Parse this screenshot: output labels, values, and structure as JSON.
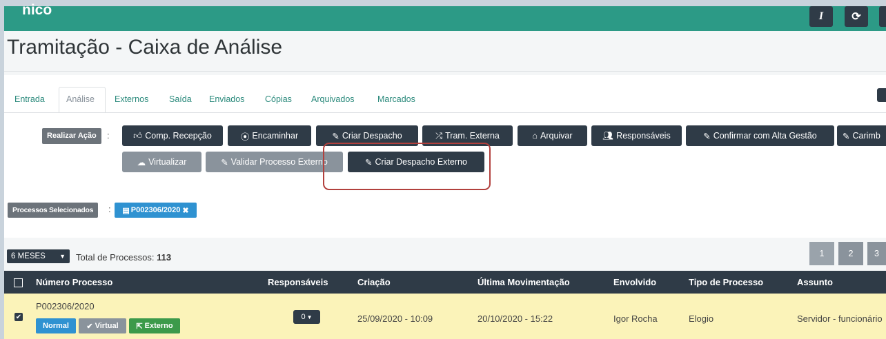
{
  "app": {
    "brand": "nico",
    "top_buttons": [
      {
        "icon": "italic-icon",
        "label": "I"
      },
      {
        "icon": "refresh-icon",
        "label": "⟳"
      }
    ]
  },
  "page_title": "Tramitação - Caixa de Análise",
  "tabs": [
    {
      "label": "Entrada",
      "active": false
    },
    {
      "label": "Análise",
      "active": true
    },
    {
      "label": "Externos",
      "active": false
    },
    {
      "label": "Saída",
      "active": false
    },
    {
      "label": "Enviados",
      "active": false
    },
    {
      "label": "Cópias",
      "active": false
    },
    {
      "label": "Arquivados",
      "active": false
    },
    {
      "label": "Marcados",
      "active": false
    }
  ],
  "actions": {
    "label": "Realizar Ação",
    "row1": [
      {
        "icon": "thumbs-up-icon",
        "label": "Comp. Recepção"
      },
      {
        "icon": "forward-circle-icon",
        "label": "Encaminhar"
      },
      {
        "icon": "edit-icon",
        "label": "Criar Despacho"
      },
      {
        "icon": "shuffle-icon",
        "label": "Tram. Externa"
      },
      {
        "icon": "inbox-icon",
        "label": "Arquivar"
      },
      {
        "icon": "users-icon",
        "label": "Responsáveis"
      },
      {
        "icon": "edit-icon",
        "label": "Confirmar com Alta Gestão"
      },
      {
        "icon": "pencil-icon",
        "label": "Carimb"
      }
    ],
    "row2": [
      {
        "icon": "cloud-upload-icon",
        "label": "Virtualizar"
      },
      {
        "icon": "edit-icon",
        "label": "Validar Processo Externo"
      },
      {
        "icon": "edit-icon",
        "label": "Criar Despacho Externo"
      }
    ]
  },
  "selected": {
    "label": "Processos Selecionados",
    "chip": "P002306/2020"
  },
  "filter": {
    "period": "6 MESES",
    "total_label": "Total de Processos:",
    "total_value": "113"
  },
  "pagination": [
    "1",
    "2",
    "3"
  ],
  "table": {
    "headers": [
      "Número Processo",
      "Responsáveis",
      "Criação",
      "Última Movimentação",
      "Envolvido",
      "Tipo de Processo",
      "Assunto"
    ],
    "rows": [
      {
        "numero": "P002306/2020",
        "responsaveis": "0",
        "criacao": "25/09/2020 - 10:09",
        "ultima": "20/10/2020 - 15:22",
        "envolvido": "Igor Rocha",
        "tipo": "Elogio",
        "assunto": "Servidor - funcionário",
        "badges": [
          "Normal",
          "Virtual",
          "Externo"
        ]
      }
    ]
  },
  "colors": {
    "topbar": "#2c9a86",
    "dark": "#2f3b47",
    "grey": "#8a939c",
    "highlight": "#b2403d",
    "chip": "#2f92d1",
    "row": "#fbf3b9"
  }
}
